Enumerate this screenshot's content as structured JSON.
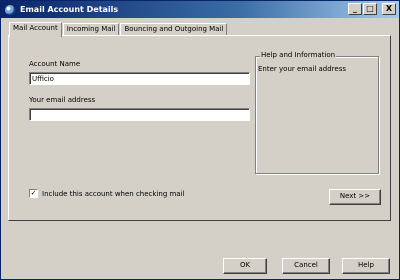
{
  "window": {
    "title": "Email Account Details",
    "icon": "globe-app-icon",
    "controls": {
      "minimize": "_",
      "maximize": "□",
      "close": "X"
    }
  },
  "tabs": [
    {
      "label": "Mail Account",
      "active": true
    },
    {
      "label": "Incoming Mail",
      "active": false
    },
    {
      "label": "Bouncing and Outgoing Mail",
      "active": false
    }
  ],
  "form": {
    "account_name_label": "Account Name",
    "account_name_value": "Ufficio",
    "email_label": "Your email address",
    "email_value": ""
  },
  "help": {
    "legend": "Help and Information",
    "text": "Enter your email address"
  },
  "include_checkbox": {
    "checked": true,
    "mark": "✓",
    "label": "Include this account when checking mail"
  },
  "buttons": {
    "next": "Next >>",
    "ok": "OK",
    "cancel": "Cancel",
    "help": "Help"
  }
}
